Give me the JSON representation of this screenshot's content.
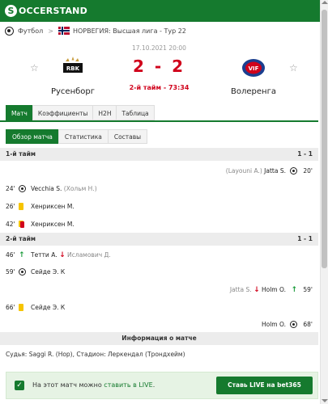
{
  "brand": {
    "part1": "S",
    "part2": "OCCERSTAND"
  },
  "breadcrumb": {
    "sport": "Футбол",
    "competition": "НОРВЕГИЯ: Высшая лига - Тур 22"
  },
  "match": {
    "date": "17.10.2021 20:00",
    "home": "Русенборг",
    "away": "Волеренга",
    "score": "2 - 2",
    "status": "2-й тайм - 73:34"
  },
  "tabs": [
    "Матч",
    "Коэффициенты",
    "H2H",
    "Таблица"
  ],
  "subtabs": [
    "Обзор матча",
    "Статистика",
    "Составы"
  ],
  "periods": [
    {
      "label": "1-й тайм",
      "score": "1 - 1"
    },
    {
      "label": "2-й тайм",
      "score": "1 - 1"
    }
  ],
  "events": [
    {
      "side": "away",
      "minute": "20'",
      "type": "goal",
      "player": "Jatta S.",
      "extra": "(Layouni A.)"
    },
    {
      "side": "home",
      "minute": "24'",
      "type": "goal",
      "player": "Vecchia S.",
      "extra": "(Хольм Н.)"
    },
    {
      "side": "home",
      "minute": "26'",
      "type": "yellow-card",
      "player": "Хенриксен М.",
      "extra": ""
    },
    {
      "side": "home",
      "minute": "42'",
      "type": "second-yellow-card",
      "player": "Хенриксен М.",
      "extra": ""
    },
    {
      "side": "home",
      "minute": "46'",
      "type": "substitution",
      "player": "Тетти А.",
      "extra": "Исламович Д."
    },
    {
      "side": "home",
      "minute": "59'",
      "type": "goal",
      "player": "Сейде Э. К",
      "extra": ""
    },
    {
      "side": "away",
      "minute": "59'",
      "type": "substitution",
      "player": "Holm O.",
      "extra": "Jatta S."
    },
    {
      "side": "home",
      "minute": "66'",
      "type": "yellow-card",
      "player": "Сейде Э. К",
      "extra": ""
    },
    {
      "side": "away",
      "minute": "68'",
      "type": "goal",
      "player": "Holm O.",
      "extra": ""
    }
  ],
  "info": {
    "heading": "Информация о матче",
    "text": "Судья: Saggi R. (Нор), Стадион: Леркендал (Трондхейм)"
  },
  "live": {
    "text_before": "На этот матч можно",
    "text_link": "ставить в LIVE",
    "text_after": ".",
    "button": "Ставь LIVE на bet365"
  },
  "colors": {
    "brand_green": "#157a2e",
    "score_red": "#d0021b",
    "yellow_card": "#f6c400"
  }
}
